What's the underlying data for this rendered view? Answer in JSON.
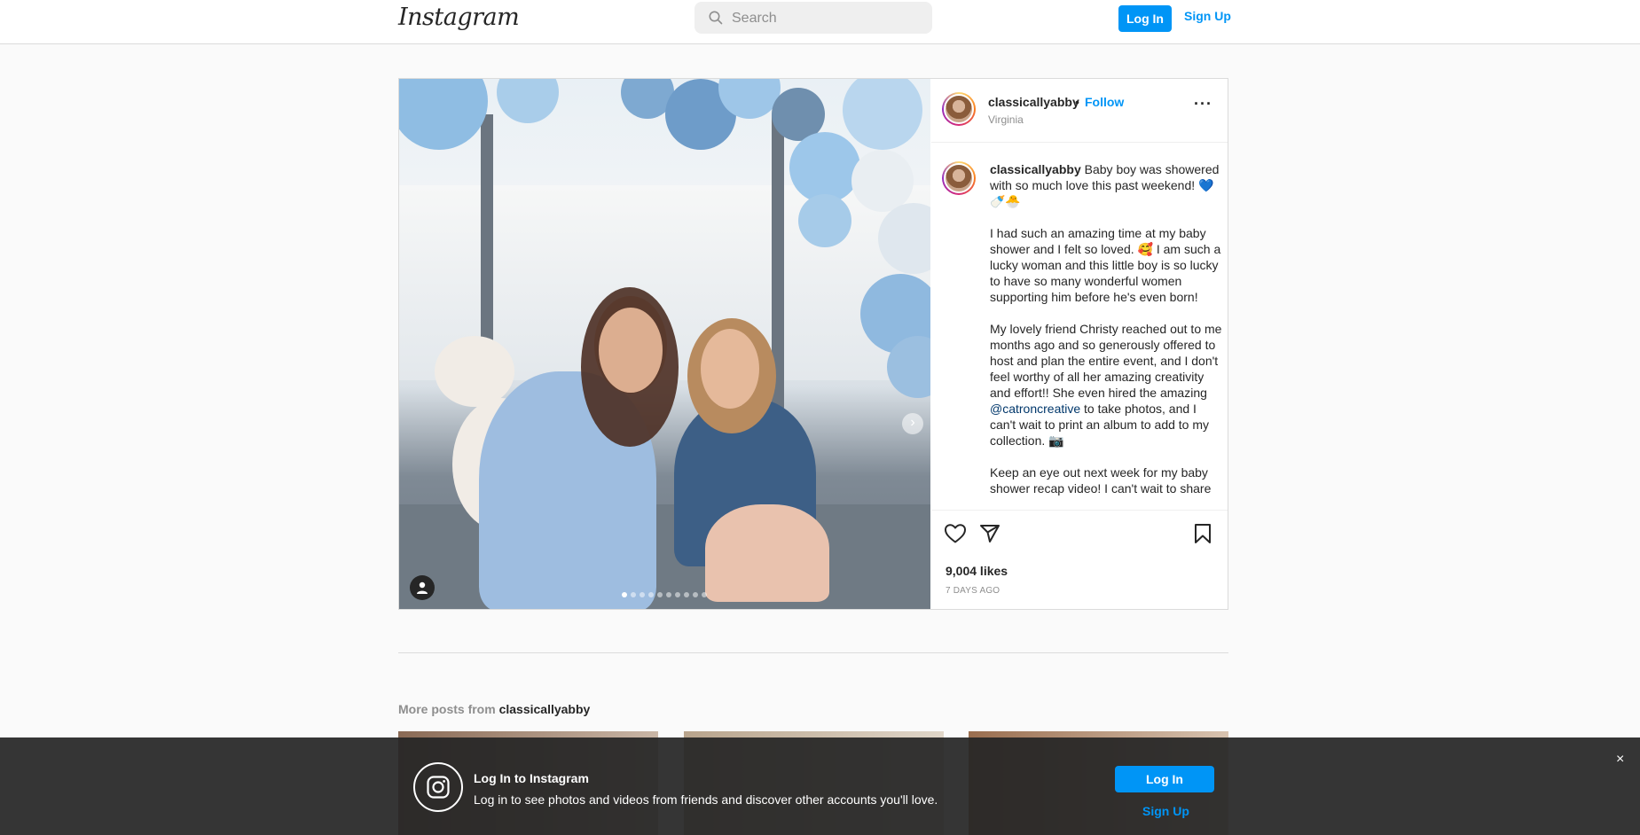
{
  "app": {
    "logo_text": "Instagram"
  },
  "search": {
    "placeholder": "Search"
  },
  "nav": {
    "login_label": "Log In",
    "signup_label": "Sign Up"
  },
  "post": {
    "username": "classicallyabby",
    "separator": "•",
    "follow_label": "Follow",
    "location": "Virginia",
    "more_label": "···",
    "caption": {
      "username": "classicallyabby",
      "p1": " Baby boy was showered with so much love this past weekend! 💙🍼🐣",
      "p2": "I had such an amazing time at my baby shower and I felt so loved. 🥰 I am such a lucky woman and this little boy is so lucky to have so many wonderful women supporting him before he's even born!",
      "p3_before": "My lovely friend Christy reached out to me months ago and so generously offered to host and plan the entire event, and I don't feel worthy of all her amazing creativity and effort!! She even hired the amazing ",
      "mention": "@catroncreative",
      "p3_after": " to take photos, and I can't wait to print an album to add to my collection. 📷",
      "p4": "Keep an eye out next week for my baby shower recap video! I can't wait to share all the details with you :)"
    },
    "likes": "9,004 likes",
    "age": "7 DAYS AGO",
    "carousel": {
      "current": 1,
      "total": 10
    },
    "icons": [
      "heart-icon",
      "share-icon",
      "bookmark-icon",
      "user-tag-icon",
      "chevron-right-icon"
    ]
  },
  "more_posts": {
    "prefix": "More posts from ",
    "username": "classicallyabby"
  },
  "banner": {
    "title": "Log In to Instagram",
    "text": "Log in to see photos and videos from friends and discover other accounts you'll love.",
    "login_label": "Log In",
    "signup_label": "Sign Up",
    "close_label": "×"
  },
  "colors": {
    "accent": "#0095f6",
    "banner_bg": "#262626",
    "mention": "#00376b"
  }
}
